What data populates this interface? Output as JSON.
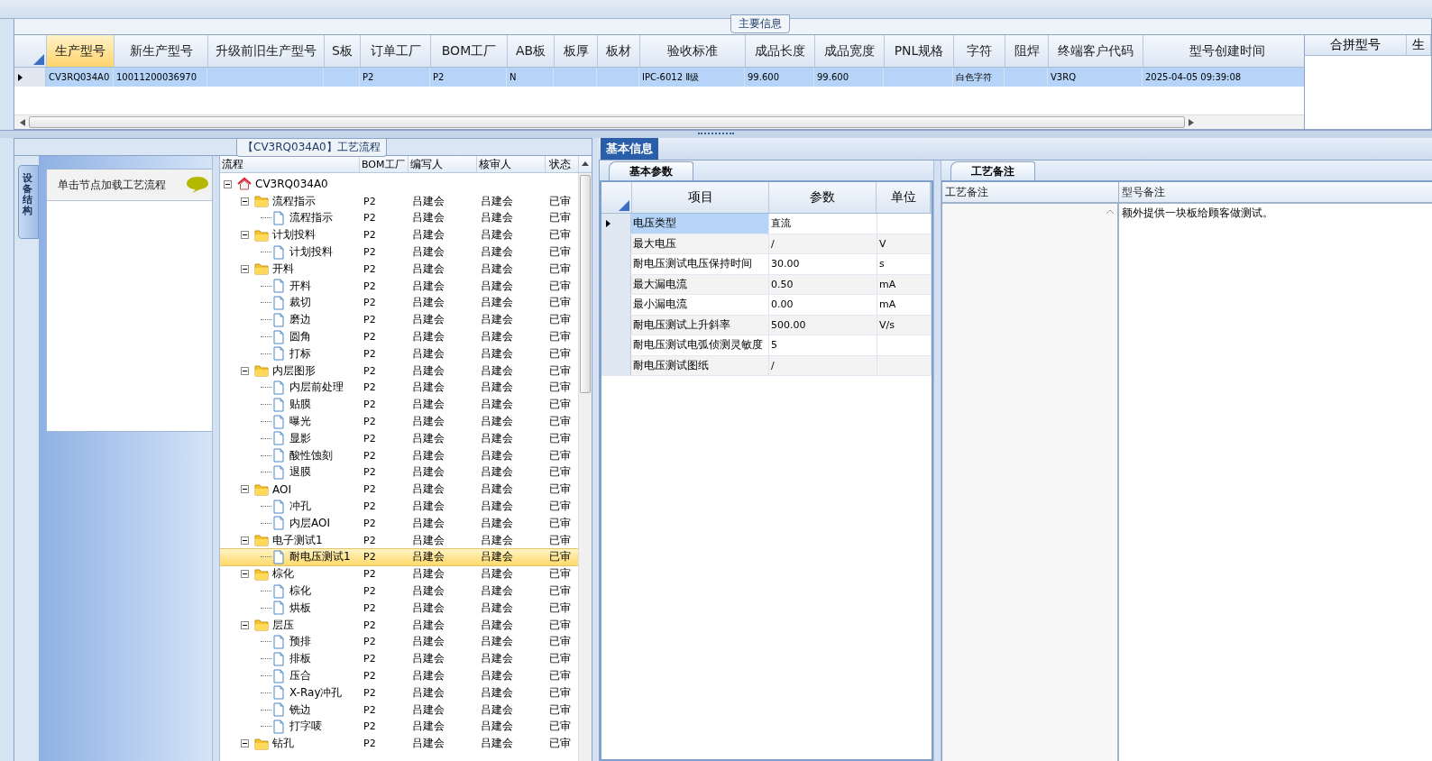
{
  "main_info": {
    "title": "主要信息",
    "columns": [
      {
        "label": "生产型号",
        "selected": true
      },
      {
        "label": "新生产型号",
        "selected": false
      },
      {
        "label": "升级前旧生产型号",
        "selected": false
      },
      {
        "label": "S板",
        "selected": false
      },
      {
        "label": "订单工厂",
        "selected": false
      },
      {
        "label": "BOM工厂",
        "selected": false
      },
      {
        "label": "AB板",
        "selected": false
      },
      {
        "label": "板厚",
        "selected": false
      },
      {
        "label": "板材",
        "selected": false
      },
      {
        "label": "验收标准",
        "selected": false
      },
      {
        "label": "成品长度",
        "selected": false
      },
      {
        "label": "成品宽度",
        "selected": false
      },
      {
        "label": "PNL规格",
        "selected": false
      },
      {
        "label": "字符",
        "selected": false
      },
      {
        "label": "阻焊",
        "selected": false
      },
      {
        "label": "终端客户代码",
        "selected": false
      },
      {
        "label": "型号创建时间",
        "selected": false
      }
    ],
    "rows": [
      {
        "selected": true,
        "cells": [
          "CV3RQ034A0",
          "10011200036970",
          "",
          "",
          "P2",
          "P2",
          "N",
          "",
          "",
          "IPC-6012 Ⅱ级",
          "99.600",
          "99.600",
          "",
          "白色字符",
          "",
          "V3RQ",
          "2025-04-05 09:39:08"
        ]
      }
    ],
    "side_columns": [
      "合拼型号",
      "生"
    ]
  },
  "process_panel": {
    "title": "【CV3RQ034A0】工艺流程",
    "side_tab": "设备结构",
    "hint": "单击节点加载工艺流程",
    "columns": [
      "流程",
      "BOM工厂",
      "编写人",
      "核审人",
      "状态"
    ],
    "nodes": [
      {
        "kind": "root",
        "label": "CV3RQ034A0",
        "expanded": true,
        "selected": false,
        "children": [
          {
            "kind": "folder",
            "label": "流程指示",
            "bom": "P2",
            "author": "吕建会",
            "reviewer": "吕建会",
            "status": "已审",
            "expanded": true,
            "selected": false,
            "children": [
              {
                "kind": "step",
                "label": "流程指示",
                "bom": "P2",
                "author": "吕建会",
                "reviewer": "吕建会",
                "status": "已审",
                "selected": false
              }
            ]
          },
          {
            "kind": "folder",
            "label": "计划投料",
            "bom": "P2",
            "author": "吕建会",
            "reviewer": "吕建会",
            "status": "已审",
            "expanded": true,
            "selected": false,
            "children": [
              {
                "kind": "step",
                "label": "计划投料",
                "bom": "P2",
                "author": "吕建会",
                "reviewer": "吕建会",
                "status": "已审",
                "selected": false
              }
            ]
          },
          {
            "kind": "folder",
            "label": "开料",
            "bom": "P2",
            "author": "吕建会",
            "reviewer": "吕建会",
            "status": "已审",
            "expanded": true,
            "selected": false,
            "children": [
              {
                "kind": "step",
                "label": "开料",
                "bom": "P2",
                "author": "吕建会",
                "reviewer": "吕建会",
                "status": "已审",
                "selected": false
              },
              {
                "kind": "step",
                "label": "裁切",
                "bom": "P2",
                "author": "吕建会",
                "reviewer": "吕建会",
                "status": "已审",
                "selected": false
              },
              {
                "kind": "step",
                "label": "磨边",
                "bom": "P2",
                "author": "吕建会",
                "reviewer": "吕建会",
                "status": "已审",
                "selected": false
              },
              {
                "kind": "step",
                "label": "圆角",
                "bom": "P2",
                "author": "吕建会",
                "reviewer": "吕建会",
                "status": "已审",
                "selected": false
              },
              {
                "kind": "step",
                "label": "打标",
                "bom": "P2",
                "author": "吕建会",
                "reviewer": "吕建会",
                "status": "已审",
                "selected": false
              }
            ]
          },
          {
            "kind": "folder",
            "label": "内层图形",
            "bom": "P2",
            "author": "吕建会",
            "reviewer": "吕建会",
            "status": "已审",
            "expanded": true,
            "selected": false,
            "children": [
              {
                "kind": "step",
                "label": "内层前处理",
                "bom": "P2",
                "author": "吕建会",
                "reviewer": "吕建会",
                "status": "已审",
                "selected": false
              },
              {
                "kind": "step",
                "label": "贴膜",
                "bom": "P2",
                "author": "吕建会",
                "reviewer": "吕建会",
                "status": "已审",
                "selected": false
              },
              {
                "kind": "step",
                "label": "曝光",
                "bom": "P2",
                "author": "吕建会",
                "reviewer": "吕建会",
                "status": "已审",
                "selected": false
              },
              {
                "kind": "step",
                "label": "显影",
                "bom": "P2",
                "author": "吕建会",
                "reviewer": "吕建会",
                "status": "已审",
                "selected": false
              },
              {
                "kind": "step",
                "label": "酸性蚀刻",
                "bom": "P2",
                "author": "吕建会",
                "reviewer": "吕建会",
                "status": "已审",
                "selected": false
              },
              {
                "kind": "step",
                "label": "退膜",
                "bom": "P2",
                "author": "吕建会",
                "reviewer": "吕建会",
                "status": "已审",
                "selected": false
              }
            ]
          },
          {
            "kind": "folder",
            "label": "AOI",
            "bom": "P2",
            "author": "吕建会",
            "reviewer": "吕建会",
            "status": "已审",
            "expanded": true,
            "selected": false,
            "children": [
              {
                "kind": "step",
                "label": "冲孔",
                "bom": "P2",
                "author": "吕建会",
                "reviewer": "吕建会",
                "status": "已审",
                "selected": false
              },
              {
                "kind": "step",
                "label": "内层AOI",
                "bom": "P2",
                "author": "吕建会",
                "reviewer": "吕建会",
                "status": "已审",
                "selected": false
              }
            ]
          },
          {
            "kind": "folder",
            "label": "电子测试1",
            "bom": "P2",
            "author": "吕建会",
            "reviewer": "吕建会",
            "status": "已审",
            "expanded": true,
            "selected": false,
            "children": [
              {
                "kind": "step",
                "label": "耐电压测试1",
                "bom": "P2",
                "author": "吕建会",
                "reviewer": "吕建会",
                "status": "已审",
                "selected": true
              }
            ]
          },
          {
            "kind": "folder",
            "label": "棕化",
            "bom": "P2",
            "author": "吕建会",
            "reviewer": "吕建会",
            "status": "已审",
            "expanded": true,
            "selected": false,
            "children": [
              {
                "kind": "step",
                "label": "棕化",
                "bom": "P2",
                "author": "吕建会",
                "reviewer": "吕建会",
                "status": "已审",
                "selected": false
              },
              {
                "kind": "step",
                "label": "烘板",
                "bom": "P2",
                "author": "吕建会",
                "reviewer": "吕建会",
                "status": "已审",
                "selected": false
              }
            ]
          },
          {
            "kind": "folder",
            "label": "层压",
            "bom": "P2",
            "author": "吕建会",
            "reviewer": "吕建会",
            "status": "已审",
            "expanded": true,
            "selected": false,
            "children": [
              {
                "kind": "step",
                "label": "预排",
                "bom": "P2",
                "author": "吕建会",
                "reviewer": "吕建会",
                "status": "已审",
                "selected": false
              },
              {
                "kind": "step",
                "label": "排板",
                "bom": "P2",
                "author": "吕建会",
                "reviewer": "吕建会",
                "status": "已审",
                "selected": false
              },
              {
                "kind": "step",
                "label": "压合",
                "bom": "P2",
                "author": "吕建会",
                "reviewer": "吕建会",
                "status": "已审",
                "selected": false
              },
              {
                "kind": "step",
                "label": "X-Ray冲孔",
                "bom": "P2",
                "author": "吕建会",
                "reviewer": "吕建会",
                "status": "已审",
                "selected": false
              },
              {
                "kind": "step",
                "label": "铣边",
                "bom": "P2",
                "author": "吕建会",
                "reviewer": "吕建会",
                "status": "已审",
                "selected": false
              },
              {
                "kind": "step",
                "label": "打字唛",
                "bom": "P2",
                "author": "吕建会",
                "reviewer": "吕建会",
                "status": "已审",
                "selected": false
              }
            ]
          },
          {
            "kind": "folder",
            "label": "钻孔",
            "bom": "P2",
            "author": "吕建会",
            "reviewer": "吕建会",
            "status": "已审",
            "expanded": true,
            "selected": false
          }
        ]
      }
    ]
  },
  "info_tab": "基本信息",
  "params": {
    "tab": "基本参数",
    "columns": [
      "项目",
      "参数",
      "单位"
    ],
    "rows": [
      {
        "item": "电压类型",
        "value": "直流",
        "unit": "",
        "selected": true
      },
      {
        "item": "最大电压",
        "value": "/",
        "unit": "V",
        "selected": false
      },
      {
        "item": "耐电压测试电压保持时间",
        "value": "30.00",
        "unit": "s",
        "selected": false
      },
      {
        "item": "最大漏电流",
        "value": "0.50",
        "unit": "mA",
        "selected": false
      },
      {
        "item": "最小漏电流",
        "value": "0.00",
        "unit": "mA",
        "selected": false
      },
      {
        "item": "耐电压测试上升斜率",
        "value": "500.00",
        "unit": "V/s",
        "selected": false
      },
      {
        "item": "耐电压测试电弧侦测灵敏度",
        "value": "5",
        "unit": "",
        "selected": false
      },
      {
        "item": "耐电压测试图纸",
        "value": "/",
        "unit": "",
        "selected": false
      }
    ]
  },
  "notes": {
    "tab": "工艺备注",
    "columns": [
      "工艺备注",
      "型号备注"
    ],
    "model_note": "额外提供一块板给顾客做测试。"
  }
}
